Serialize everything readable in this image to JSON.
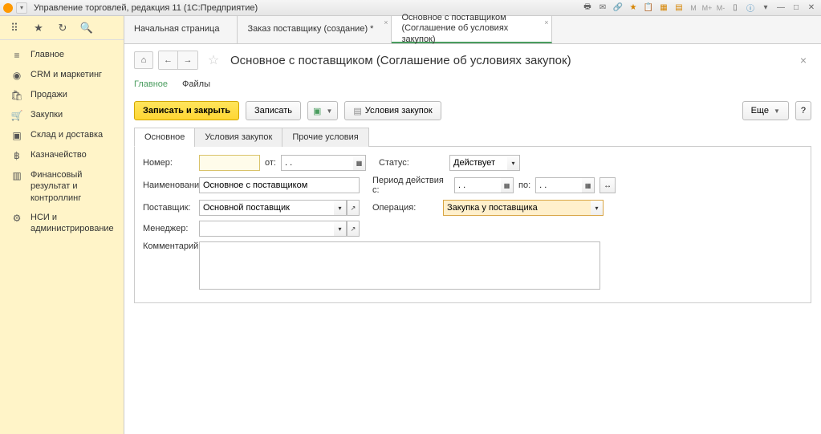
{
  "titlebar": {
    "title": "Управление торговлей, редакция 11  (1С:Предприятие)"
  },
  "sidebar": {
    "items": [
      {
        "icon": "home",
        "label": "Главное"
      },
      {
        "icon": "crm",
        "label": "CRM и маркетинг"
      },
      {
        "icon": "bag",
        "label": "Продажи"
      },
      {
        "icon": "cart",
        "label": "Закупки"
      },
      {
        "icon": "box",
        "label": "Склад и доставка"
      },
      {
        "icon": "money",
        "label": "Казначейство"
      },
      {
        "icon": "chart",
        "label": "Финансовый результат и контроллинг"
      },
      {
        "icon": "gear",
        "label": "НСИ и администрирование"
      }
    ]
  },
  "tabs": [
    {
      "label": "Начальная страница",
      "active": false,
      "closable": false
    },
    {
      "label": "Заказ поставщику (создание) *",
      "active": false,
      "closable": true
    },
    {
      "label": "Основное с поставщиком (Соглашение об условиях закупок)",
      "active": true,
      "closable": true
    }
  ],
  "page": {
    "title": "Основное с поставщиком (Соглашение об условиях закупок)"
  },
  "subtabs": [
    {
      "label": "Главное",
      "active": true
    },
    {
      "label": "Файлы",
      "active": false
    }
  ],
  "toolbar": {
    "save_close": "Записать и закрыть",
    "save": "Записать",
    "conditions": "Условия закупок",
    "more": "Еще"
  },
  "form_tabs": [
    {
      "label": "Основное",
      "active": true
    },
    {
      "label": "Условия закупок",
      "active": false
    },
    {
      "label": "Прочие условия",
      "active": false
    }
  ],
  "form": {
    "number_label": "Номер:",
    "number_value": "",
    "from_label": "от:",
    "from_value": ". .",
    "status_label": "Статус:",
    "status_value": "Действует",
    "name_label": "Наименование:",
    "name_value": "Основное с поставщиком",
    "period_label": "Период действия с:",
    "period_from": ". .",
    "period_to_label": "по:",
    "period_to": ". .",
    "supplier_label": "Поставщик:",
    "supplier_value": "Основной поставщик",
    "operation_label": "Операция:",
    "operation_value": "Закупка у поставщика",
    "manager_label": "Менеджер:",
    "manager_value": "",
    "comment_label": "Комментарий:",
    "comment_value": ""
  }
}
